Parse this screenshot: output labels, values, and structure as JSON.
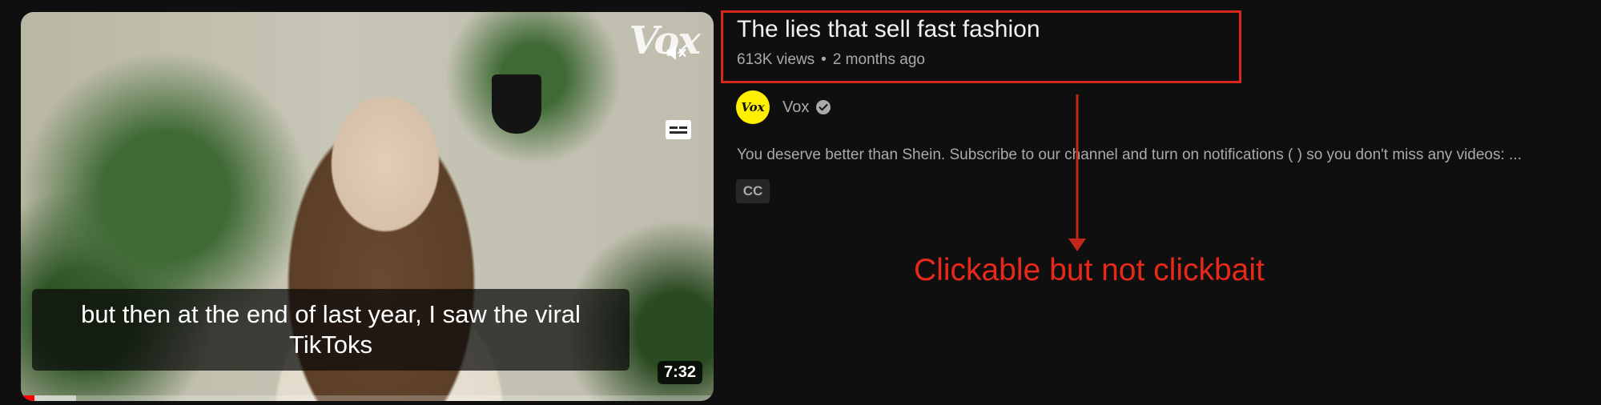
{
  "video": {
    "watermark": "Vox",
    "caption": "but then at the end of last year, I saw the viral TikToks",
    "duration": "7:32",
    "progress_played_pct": 2,
    "progress_buffered_pct": 8,
    "icons": [
      "mute-icon",
      "captions-icon"
    ]
  },
  "info": {
    "title": "The lies that sell fast fashion",
    "views": "613K views",
    "separator": "•",
    "age": "2 months ago",
    "channel": {
      "avatar_text": "Vox",
      "name": "Vox",
      "verified_icon": "verified-check-icon"
    },
    "description": "You deserve better than Shein. Subscribe to our channel and turn on notifications ( ) so you don't miss any videos: ...",
    "cc_badge": "CC"
  },
  "annotation": {
    "text": "Clickable but not clickbait",
    "color": "#e8291a"
  },
  "colors": {
    "background": "#0f0f0f",
    "highlight_box": "#d4291b",
    "avatar": "#ffef00",
    "progress": "#ff0000"
  }
}
